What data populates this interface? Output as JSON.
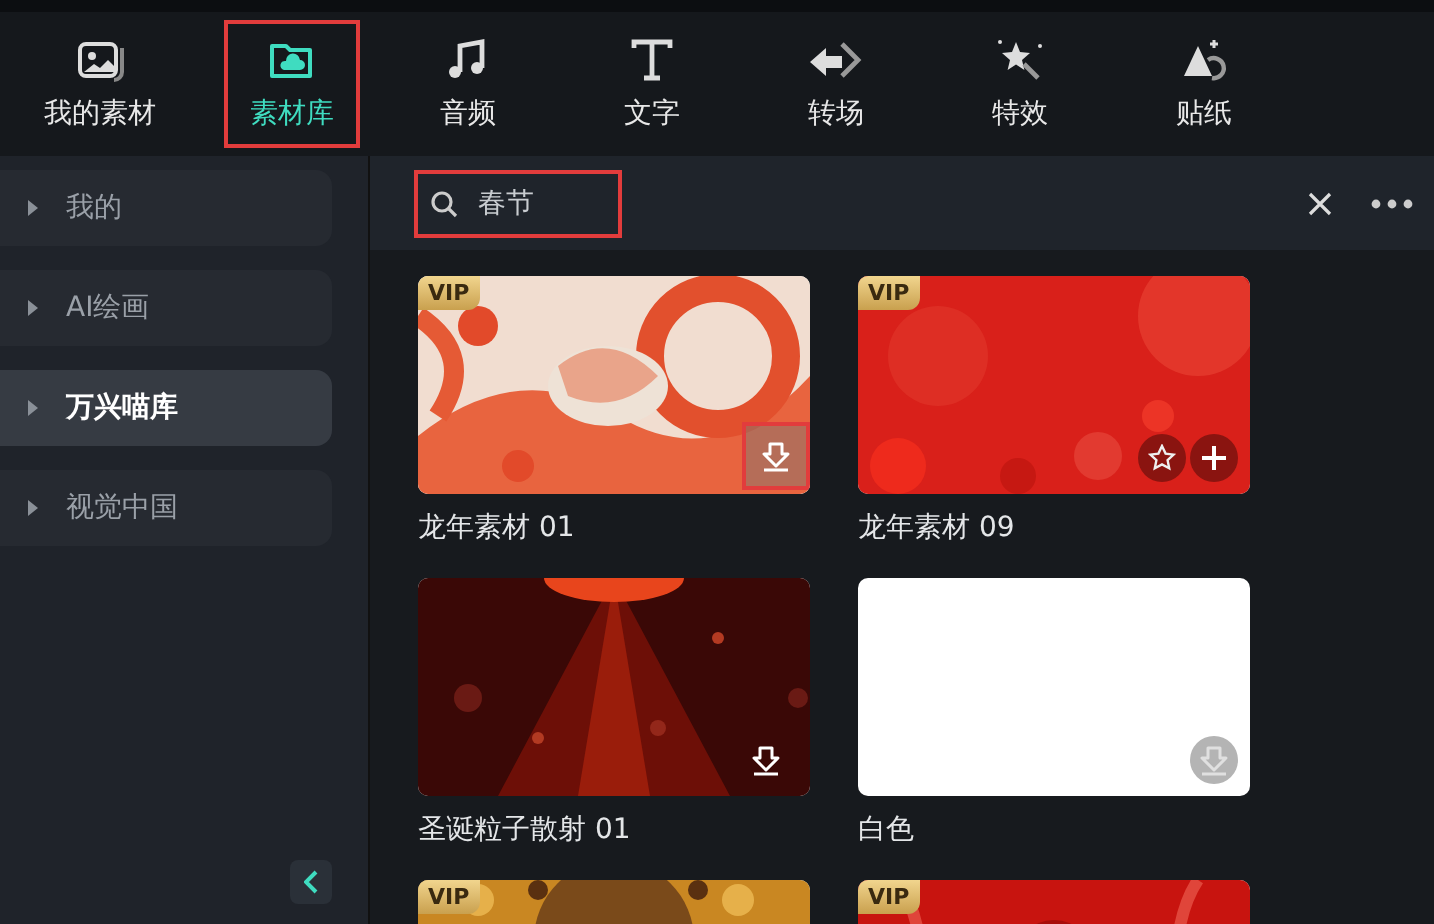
{
  "tabs": [
    {
      "label": "我的素材",
      "selected": false
    },
    {
      "label": "素材库",
      "selected": true
    },
    {
      "label": "音频",
      "selected": false
    },
    {
      "label": "文字",
      "selected": false
    },
    {
      "label": "转场",
      "selected": false
    },
    {
      "label": "特效",
      "selected": false
    },
    {
      "label": "贴纸",
      "selected": false
    }
  ],
  "sidebar": {
    "items": [
      {
        "label": "我的",
        "selected": false
      },
      {
        "label": "AI绘画",
        "selected": false
      },
      {
        "label": "万兴喵库",
        "selected": true
      },
      {
        "label": "视觉中国",
        "selected": false
      }
    ]
  },
  "search": {
    "value": "春节"
  },
  "assets": [
    {
      "title": "龙年素材 01",
      "badge": "VIP",
      "kind": "picture",
      "actions": [
        {
          "kind": "download",
          "highlighted": true,
          "disabled": false
        }
      ]
    },
    {
      "title": "龙年素材 09",
      "badge": "VIP",
      "kind": "picture",
      "actions": [
        {
          "kind": "favorite"
        },
        {
          "kind": "add"
        }
      ]
    },
    {
      "title": "圣诞粒子散射 01",
      "kind": "picture",
      "actions": [
        {
          "kind": "download",
          "highlighted": false,
          "disabled": false
        }
      ]
    },
    {
      "title": "白色",
      "kind": "blank",
      "actions": [
        {
          "kind": "download",
          "highlighted": false,
          "disabled": true
        }
      ]
    },
    {
      "badge": "VIP",
      "kind": "picture"
    },
    {
      "badge": "VIP",
      "kind": "picture"
    }
  ]
}
